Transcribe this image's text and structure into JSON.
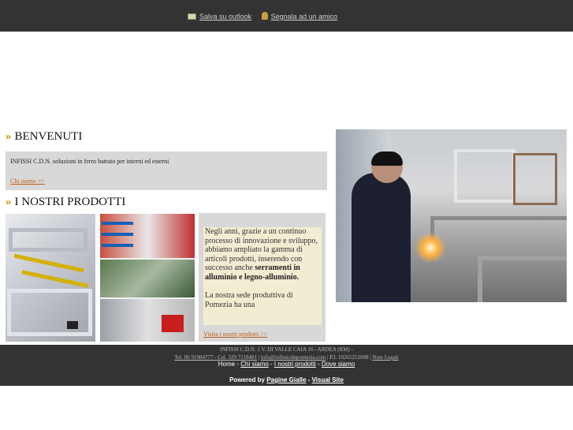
{
  "header": {
    "save_outlook": "Salva su outlook",
    "signal_friend": "Segnala ad un amico"
  },
  "welcome": {
    "title": "BENVENUTI",
    "text": "INFISSI C.D.N. soluzioni in ferro battuto per interni ed esterni",
    "link": "Chi siamo >>"
  },
  "products": {
    "title": "I NOSTRI PRODOTTI",
    "paragraph_start": "Negli anni, grazie a un continuo processo di innovazione e sviluppo, abbiamo ampliato la gamma di articoli prodotti, inserendo con successo anche ",
    "paragraph_bold": "serramenti in alluminio e legno-alluminio.",
    "paragraph2": "La nostra sede produttiva di Pomezia ha una",
    "link": "Visita i nostri prodotti >>"
  },
  "footer": {
    "line1": "INFISSI C.D.N. 1 V. DI VALLE CAIA 16 - ARDEA (RM) -",
    "tel": "Tel. 06 91984777 - Cel. 329 7118481",
    "email": "info@infissicdnpomezia.com",
    "piva": "P.I. 10265251008",
    "legal": "Note Legali",
    "nav": [
      "Home",
      "Chi siamo",
      "I nostri prodotti",
      "Dove siamo"
    ],
    "powered": "Powered by",
    "pagine": "Pagine Gialle",
    "visual": "Visual Site"
  },
  "colors": {
    "bar": "#333333",
    "accent": "#d48c00",
    "link": "#c0601a",
    "box": "#d8d8d8"
  },
  "icons": [
    "mail-icon",
    "user-icon"
  ]
}
